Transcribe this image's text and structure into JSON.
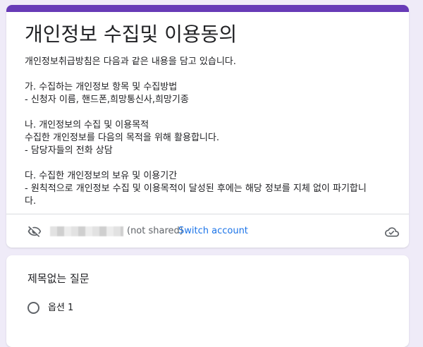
{
  "form": {
    "title": "개인정보 수집및 이용동의",
    "description": "개인정보취급방침은 다음과 같은 내용을 담고 있습니다.\n\n가. 수집하는 개인정보 항목 및 수집방법\n- 신청자 이름, 핸드폰,희망통신사,희망기종\n\n나. 개인정보의 수집 및 이용목적\n수집한 개인정보를 다음의 목적을 위해 활용합니다.\n- 담당자들의 전화 상담\n\n다. 수집한 개인정보의 보유 및 이용기간\n- 원칙적으로 개인정보 수집 및 이용목적이 달성된 후에는 해당 정보를 지체 없이 파기합니\n다."
  },
  "account": {
    "not_shared_label": "(not shared)",
    "switch_account_label": "Switch account",
    "email_hidden_icon": "eye-off-icon",
    "draft_icon": "cloud-done-icon"
  },
  "question": {
    "title": "제목없는 질문",
    "options": [
      {
        "label": "옵션 1"
      }
    ]
  },
  "colors": {
    "accent": "#673ab7",
    "background": "#efebf8",
    "link": "#1a73e8"
  }
}
